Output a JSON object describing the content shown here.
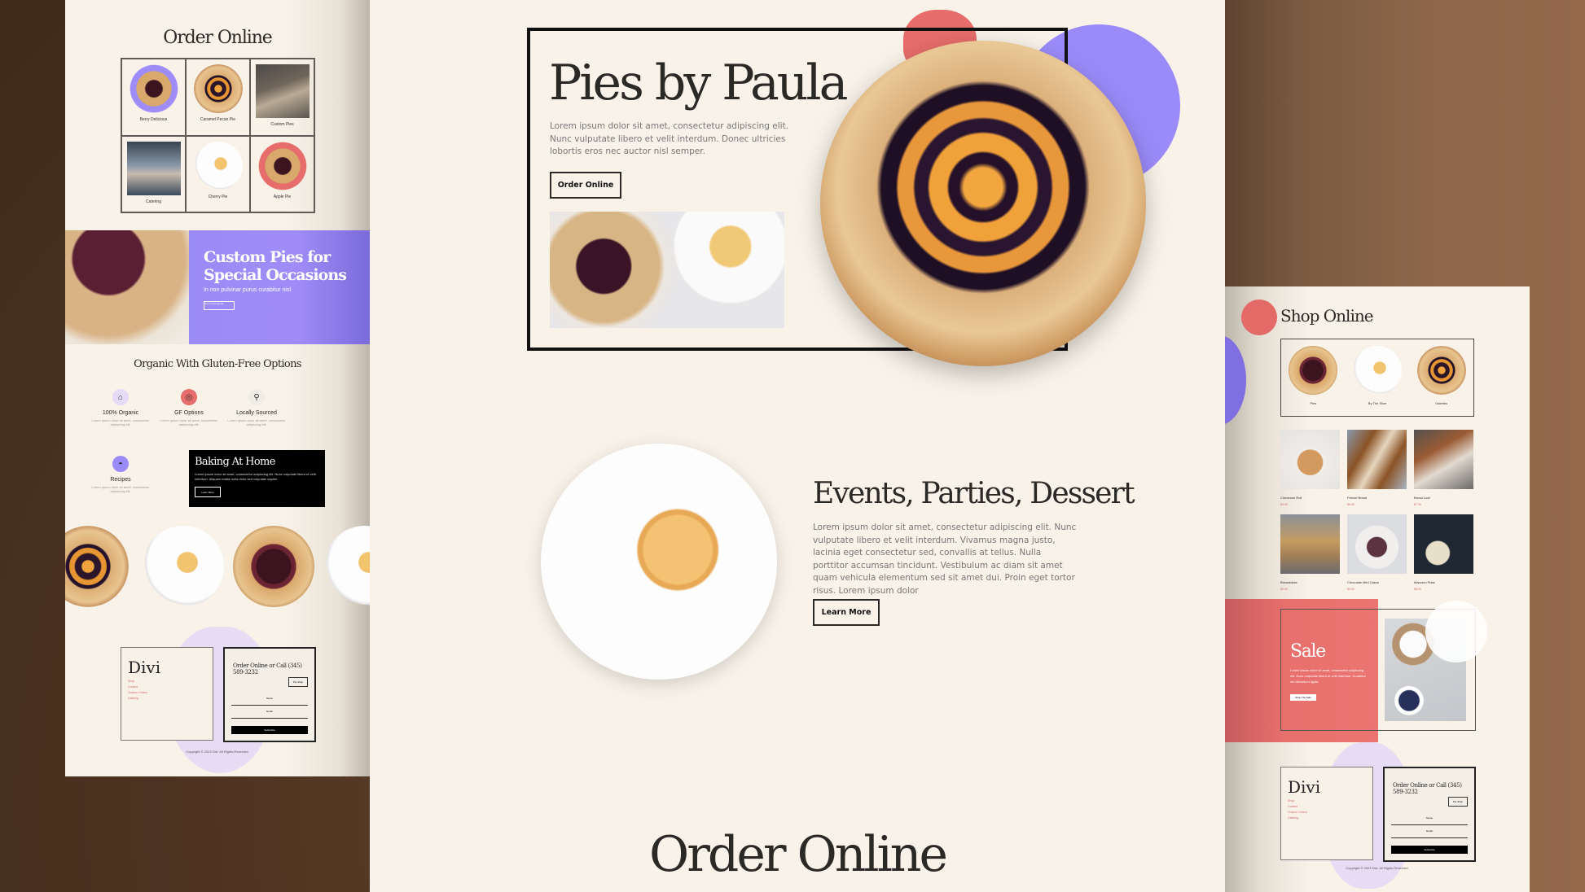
{
  "left_panel": {
    "order_online_title": "Order Online",
    "grid_items": [
      {
        "label": "Berry Delicious",
        "icon": "berry-pie-purple-badge"
      },
      {
        "label": "Caramel Pecan Pie",
        "icon": "peach-pie"
      },
      {
        "label": "Custom Pies",
        "icon": "flour-bags-photo"
      },
      {
        "label": "Catering",
        "icon": "kneading-dough-photo"
      },
      {
        "label": "Cherry Pie",
        "icon": "pie-slice-plate"
      },
      {
        "label": "Apple Pie",
        "icon": "berry-pie-coral-badge"
      }
    ],
    "custom_pies": {
      "title_line1": "Custom Pies for",
      "title_line2": "Special Occasions",
      "subtitle": "In non pulvinar purus curabitur nisl",
      "button": "Get A Free Quote"
    },
    "organic_title": "Organic With Gluten-Free Options",
    "features": [
      {
        "title": "100% Organic",
        "icon": "cake-stand-icon",
        "desc": "Lorem ipsum dolor sit amet, consectetur adipiscing elit."
      },
      {
        "title": "GF Options",
        "icon": "gf-icon",
        "desc": "Lorem ipsum dolor sit amet, consectetur adipiscing elit."
      },
      {
        "title": "Locally Sourced",
        "icon": "search-icon",
        "desc": "Lorem ipsum dolor sit amet, consectetur adipiscing elit."
      },
      {
        "title": "Recipes",
        "icon": "recipe-bowl-icon",
        "desc": "Lorem ipsum dolor sit amet, consectetur adipiscing elit."
      }
    ],
    "baking": {
      "title": "Baking At Home",
      "desc": "Lorem ipsum dolor sit amet, consectetur adipiscing elit. Nunc vulputate libero et velit interdum. Aliquam mattis nulla dolor sed vulputate sapien.",
      "button": "Learn More"
    },
    "footer": {
      "logo": "Divi",
      "links": [
        "Shop",
        "Contact",
        "Custom Orders",
        "Catering"
      ],
      "order_heading": "Order Online or Call (345) 589-3232",
      "shop_button": "Pie Shop",
      "name_placeholder": "Name",
      "email_placeholder": "Email",
      "subscribe": "Subscribe",
      "copyright": "Copyright © 2023 Divi. All Rights Reserved."
    }
  },
  "center_panel": {
    "hero": {
      "title": "Pies by Paula",
      "desc": "Lorem ipsum dolor sit amet, consectetur adipiscing elit. Nunc vulputate libero et velit interdum. Donec ultricies lobortis eros nec auctor nisl semper.",
      "button": "Order Online"
    },
    "events": {
      "title": "Events, Parties, Dessert",
      "desc": "Lorem ipsum dolor sit amet, consectetur adipiscing elit. Nunc vulputate libero et velit interdum. Vivamus magna justo, lacinia eget consectetur sed, convallis at tellus. Nulla porttitor accumsan tincidunt. Vestibulum ac diam sit amet quam vehicula elementum sed sit amet dui. Proin eget tortor risus. Lorem ipsum dolor",
      "button": "Learn More"
    },
    "order_title": "Order Online"
  },
  "right_panel": {
    "shop_title": "Shop Online",
    "categories": [
      {
        "label": "Pies"
      },
      {
        "label": "By The Slice"
      },
      {
        "label": "Galettes"
      }
    ],
    "products": [
      {
        "name": "Cinnamon Roll",
        "price": "$4.99",
        "photo": "cinnamon-roll"
      },
      {
        "name": "Pretzel Bread",
        "price": "$6.99",
        "photo": "pretzel-bread"
      },
      {
        "name": "Bread Loaf",
        "price": "$7.99",
        "photo": "bread-loaf"
      },
      {
        "name": "Breadsticks",
        "price": "$5.99",
        "photo": "breadsticks"
      },
      {
        "name": "Chocolate Mini Cakes",
        "price": "$3.99",
        "photo": "mini-cakes"
      },
      {
        "name": "Macaron Plate",
        "price": "$8.99",
        "photo": "macarons"
      }
    ],
    "sale": {
      "title": "Sale",
      "desc": "Lorem ipsum dolor sit amet, consectetur adipiscing elit. Nunc vulputate libero et velit interdum. Curabitur vel bibendum ligula.",
      "button": "Shop The Sale"
    },
    "footer": {
      "logo": "Divi",
      "links": [
        "Shop",
        "Contact",
        "Custom Orders",
        "Catering"
      ],
      "order_heading": "Order Online or Call (345) 589-3232",
      "shop_button": "Pie Shop",
      "name_placeholder": "Name",
      "email_placeholder": "Email",
      "subscribe": "Subscribe",
      "copyright": "Copyright © 2023 Divi. All Rights Reserved."
    }
  },
  "colors": {
    "cream": "#f8f2e9",
    "purple": "#9b8bfa",
    "coral": "#e66d6b",
    "text_dark": "#2b2926",
    "background_brown": "#5a3f28"
  }
}
